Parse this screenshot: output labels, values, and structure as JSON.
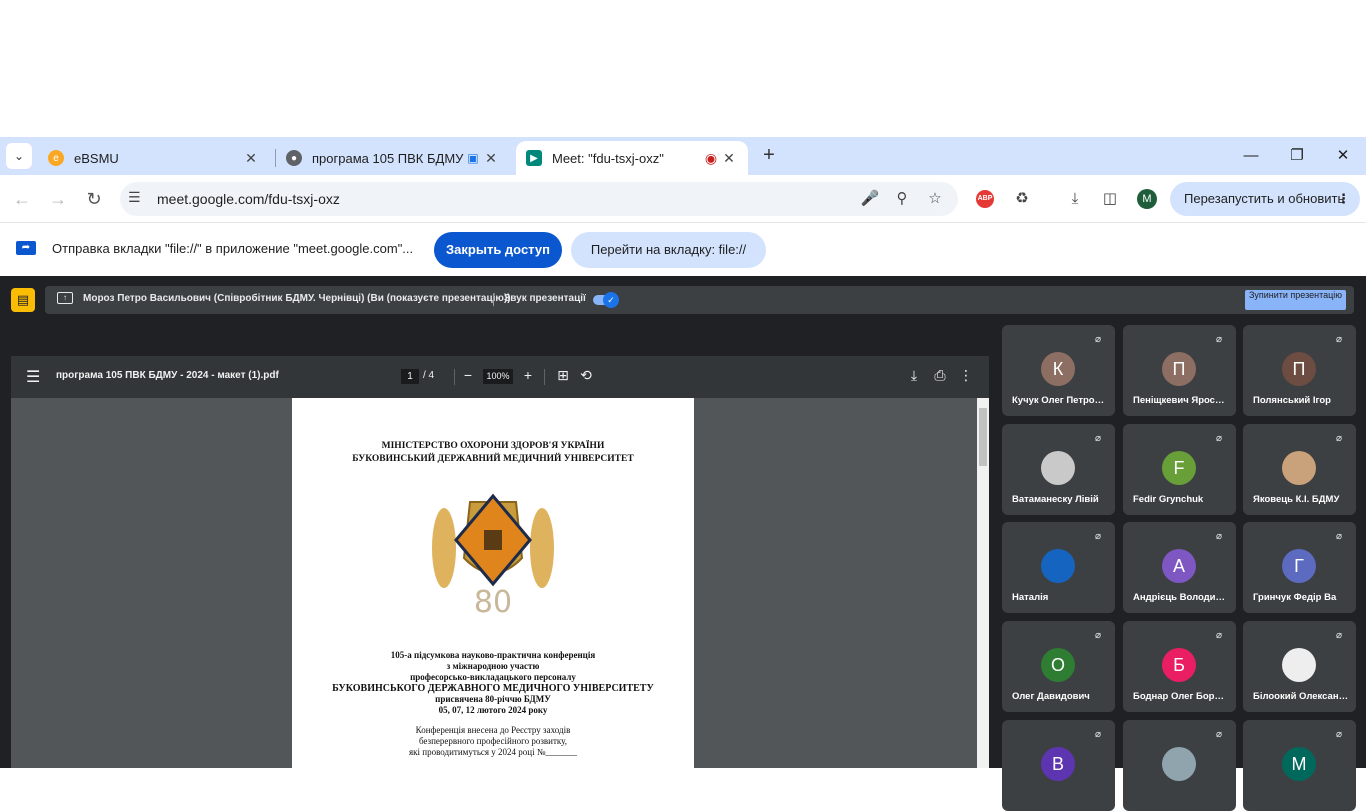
{
  "tabs": [
    {
      "title": "eBSMU",
      "active": false
    },
    {
      "title": "програма 105 ПВК БДМУ -",
      "active": false
    },
    {
      "title": "Meet: \"fdu-tsxj-oxz\"",
      "active": true
    }
  ],
  "address": {
    "url": "meet.google.com/fdu-tsxj-oxz"
  },
  "toolbar": {
    "restart_label": "Перезапустить и обновить",
    "profile_initial": "M",
    "abp_label": "ABP"
  },
  "infobar": {
    "text": "Отправка вкладки \"file://\" в приложение \"meet.google.com\"...",
    "stop_label": "Закрыть доступ",
    "goto_label": "Перейти на вкладку: file://"
  },
  "meet": {
    "presenter": "Мороз Петро Васильович (Співробітник БДМУ. Чернівці) (Ви (показуєте презентацію))",
    "audio_label": "Звук презентації",
    "stop_label": "Зупинити презентацію"
  },
  "pdf": {
    "filename": "програма 105 ПВК БДМУ - 2024 - макет (1).pdf",
    "page": "1",
    "total": "/ 4",
    "zoom": "100%",
    "header": [
      "МІНІСТЕРСТВО ОХОРОНИ ЗДОРОВ'Я УКРАЇНИ",
      "БУКОВИНСЬКИЙ ДЕРЖАВНИЙ МЕДИЧНИЙ УНІВЕРСИТЕТ"
    ],
    "emblem_text": "80",
    "conference": [
      "105-а підсумкова науково-практична конференція",
      "з міжнародною участю",
      "професорсько-викладацького персоналу",
      "БУКОВИНСЬКОГО ДЕРЖАВНОГО МЕДИЧНОГО УНІВЕРСИТЕТУ",
      "присвячена 80-річчю БДМУ",
      "05, 07, 12 лютого 2024 року"
    ],
    "registry": [
      "Конференція внесена до Реєстру заходів",
      "безперервного професійного розвитку,",
      "які проводитимуться у 2024 році №_______"
    ]
  },
  "participants": [
    {
      "name": "Кучук Олег Петрович",
      "initial": "К",
      "color": "#8d6e63"
    },
    {
      "name": "Пеніщкевич Ярослав",
      "initial": "П",
      "color": "#8d6e63"
    },
    {
      "name": "Полянський Ігор",
      "initial": "П",
      "color": "#6d4c41"
    },
    {
      "name": "Ватаманеску Лівій",
      "initial": "",
      "color": "#c9c9c9"
    },
    {
      "name": "Fedir Grynchuk",
      "initial": "F",
      "color": "#689f38"
    },
    {
      "name": "Яковець К.І. БДМУ",
      "initial": "",
      "color": "#c9a17a"
    },
    {
      "name": "Наталія",
      "initial": "",
      "color": "#1565c0"
    },
    {
      "name": "Андрієць Володимир",
      "initial": "А",
      "color": "#7e57c2"
    },
    {
      "name": "Гринчук Федір Ва",
      "initial": "Г",
      "color": "#5c6bc0"
    },
    {
      "name": "Олег Давидович",
      "initial": "О",
      "color": "#2e7d32"
    },
    {
      "name": "Боднар Олег Борисович",
      "initial": "Б",
      "color": "#e91e63"
    },
    {
      "name": "Білоокий Олександр",
      "initial": "",
      "color": "#eeeeee"
    },
    {
      "name": "",
      "initial": "В",
      "color": "#5e35b1"
    },
    {
      "name": "",
      "initial": "",
      "color": "#90a4ae"
    },
    {
      "name": "",
      "initial": "М",
      "color": "#00695c"
    }
  ]
}
